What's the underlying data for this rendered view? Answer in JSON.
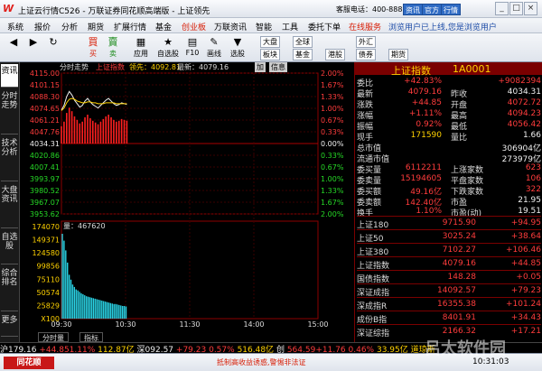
{
  "window": {
    "title": "上证云行情C526 - 万联证券同花顺高端版 - 上证领先",
    "service": "客服电话：400-8888-133",
    "buttons": [
      "资讯",
      "官方",
      "行情"
    ]
  },
  "menu": [
    "系统",
    "报价",
    "分析",
    "期货",
    "扩展行情",
    "基金",
    "创业板",
    "万联资讯",
    "智能",
    "工具",
    "委托下单",
    "在线服务",
    "浏览用户已上线,您是浏览用户"
  ],
  "toolbar": {
    "items": [
      "买",
      "卖",
      "",
      "应用",
      "自选股",
      "F10",
      "画线",
      "选股"
    ],
    "buttons": [
      "大盘",
      "板块",
      "全球",
      "基金",
      "外汇",
      "债券",
      "港股",
      "期货"
    ]
  },
  "lefttabs": [
    "资讯",
    "分时走势",
    "技术分析",
    "大盘资讯",
    "自选股",
    "综合排名",
    "更多"
  ],
  "chart": {
    "header": [
      "分时走势",
      "上证指数",
      "领先：4092.81",
      "最新：4079.16"
    ],
    "actions": [
      "加",
      "信息"
    ],
    "price_ticks": [
      "4115.00",
      "4101.15",
      "4088.30",
      "4074.65",
      "4061.21",
      "4047.76",
      "4034.31",
      "4020.86",
      "4007.41",
      "3993.97",
      "3980.52",
      "3967.07",
      "3953.62"
    ],
    "pct_ticks": [
      "2.00%",
      "1.67%",
      "1.33%",
      "1.00%",
      "0.67%",
      "0.33%",
      "0.00%",
      "0.33%",
      "0.67%",
      "1.00%",
      "1.33%",
      "1.67%",
      "2.00%"
    ],
    "vol_label": "量：467620",
    "vol_ticks": [
      "174070",
      "149371",
      "124580",
      "99856",
      "75110",
      "50574",
      "25829",
      "X100"
    ],
    "time_ticks": [
      "09:30",
      "10:30",
      "11:30",
      "14:00",
      "15:00"
    ],
    "btn": "区间",
    "tabs": [
      "分时量",
      "指标"
    ]
  },
  "quote": {
    "title": "上证指数",
    "code": "1A0001",
    "rows": [
      {
        "l": "委比",
        "v": "+42.83%",
        "v2": "+9082394"
      },
      {
        "l": "最新",
        "v": "4079.16",
        "l2": "昨收",
        "v2": "4034.31"
      },
      {
        "l": "涨跌",
        "v": "+44.85",
        "l2": "开盘",
        "v2": "4072.72"
      },
      {
        "l": "涨幅",
        "v": "+1.11%",
        "l2": "最高",
        "v2": "4094.23"
      },
      {
        "l": "振幅",
        "v": "0.92%",
        "l2": "最低",
        "v2": "4056.42"
      },
      {
        "l": "现手",
        "v": "171590",
        "l2": "量比",
        "v2": "1.66"
      },
      {
        "l": "总市值",
        "v2": "306904亿"
      },
      {
        "l": "流通市值",
        "v2": "273979亿"
      },
      {
        "l": "委买量",
        "v": "6112211",
        "l2": "上涨家数",
        "v2": "623"
      },
      {
        "l": "委卖量",
        "v": "15194605",
        "l2": "平盘家数",
        "v2": "106"
      },
      {
        "l": "委买额",
        "v": "49.16亿",
        "l2": "下跌家数",
        "v2": "322"
      },
      {
        "l": "委卖额",
        "v": "142.40亿",
        "l2": "市盈",
        "v2": "21.95"
      },
      {
        "l": "换手",
        "v": "1.10%",
        "l2": "市盈(动)",
        "v2": "19.51"
      }
    ],
    "indices": [
      {
        "n": "上证180",
        "v": "9715.90",
        "c": "+94.95"
      },
      {
        "n": "上证50",
        "v": "3025.24",
        "c": "+38.64"
      },
      {
        "n": "上证380",
        "v": "7102.27",
        "c": "+106.46"
      },
      {
        "n": "上证指数",
        "v": "4079.16",
        "c": "+44.85"
      },
      {
        "n": "国债指数",
        "v": "148.28",
        "c": "+0.05"
      },
      {
        "n": "深证成指",
        "v": "14092.57",
        "c": "+79.23"
      },
      {
        "n": "深成指R",
        "v": "16355.38",
        "c": "+101.24"
      },
      {
        "n": "成份B指",
        "v": "8401.91",
        "c": "+34.43"
      },
      {
        "n": "深证综指",
        "v": "2166.32",
        "c": "+17.21"
      }
    ]
  },
  "status": "沪179.16 +44.851.11% 112.87亿 深092.57 +79.23 0.57% 516.48亿 创 564.59+11.76 0.46% 33.95亿 道琼斯",
  "bottom": {
    "brand": "同花顺",
    "news": "抵制高收益诱惑,警惕非法证",
    "clock": "10:31:03",
    "watermark": "吕太软件园"
  },
  "colors": {
    "up": "#ff3c3c",
    "down": "#26d926",
    "accent": "#ffd200"
  }
}
